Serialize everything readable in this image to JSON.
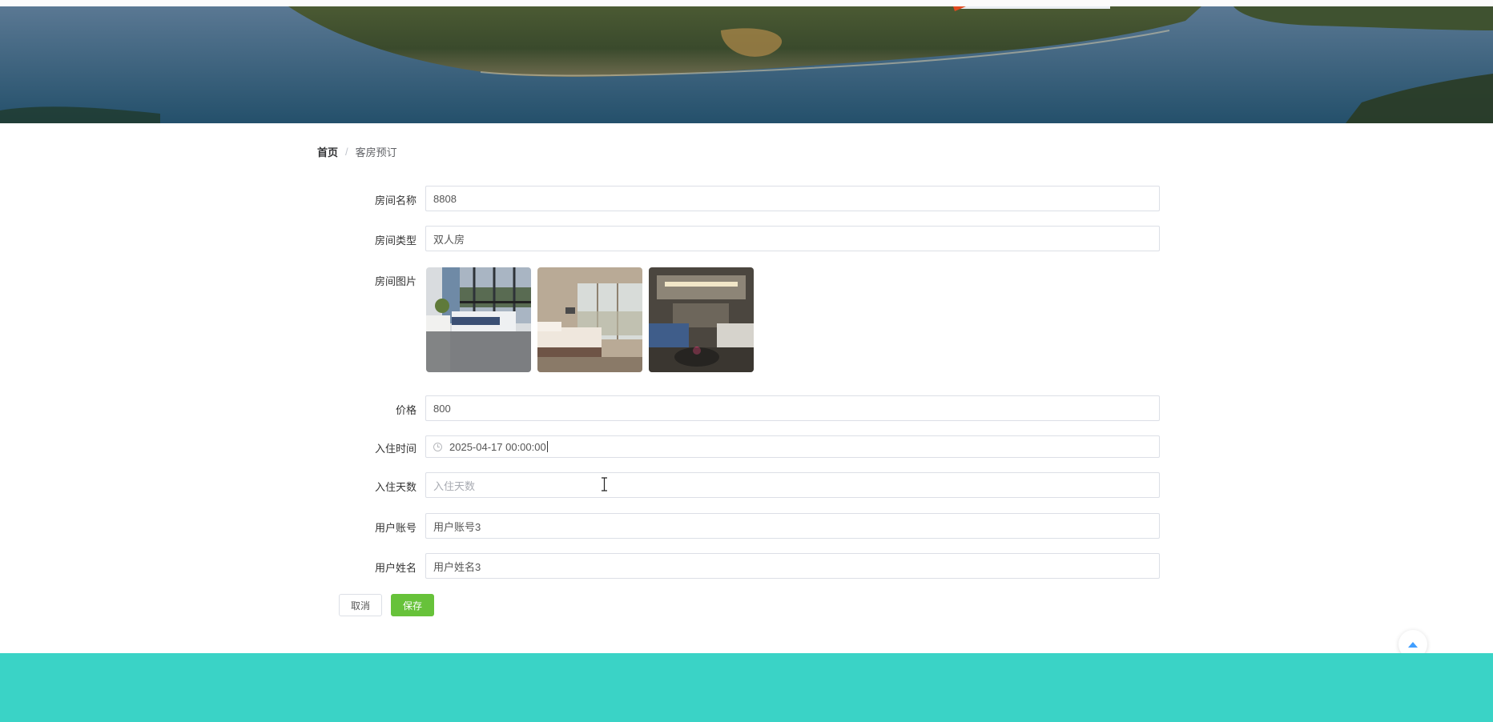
{
  "breadcrumb": {
    "home": "首页",
    "separator": "/",
    "current": "客房预订"
  },
  "form": {
    "room_name": {
      "label": "房间名称",
      "value": "8808"
    },
    "room_type": {
      "label": "房间类型",
      "value": "双人房"
    },
    "room_images": {
      "label": "房间图片"
    },
    "price": {
      "label": "价格",
      "value": "800"
    },
    "checkin_time": {
      "label": "入住时间",
      "value": "2025-04-17 00:00:00"
    },
    "checkin_days": {
      "label": "入住天数",
      "placeholder": "入住天数",
      "value": ""
    },
    "user_account": {
      "label": "用户账号",
      "value": "用户账号3"
    },
    "user_name": {
      "label": "用户姓名",
      "value": "用户姓名3"
    }
  },
  "buttons": {
    "cancel": "取消",
    "save": "保存"
  },
  "colors": {
    "primary_green": "#67c23a",
    "footer_teal": "#3ad3c6",
    "accent_blue": "#409eff"
  },
  "icons": {
    "date_prefix": "clock-icon",
    "back_to_top": "caret-up-icon"
  }
}
